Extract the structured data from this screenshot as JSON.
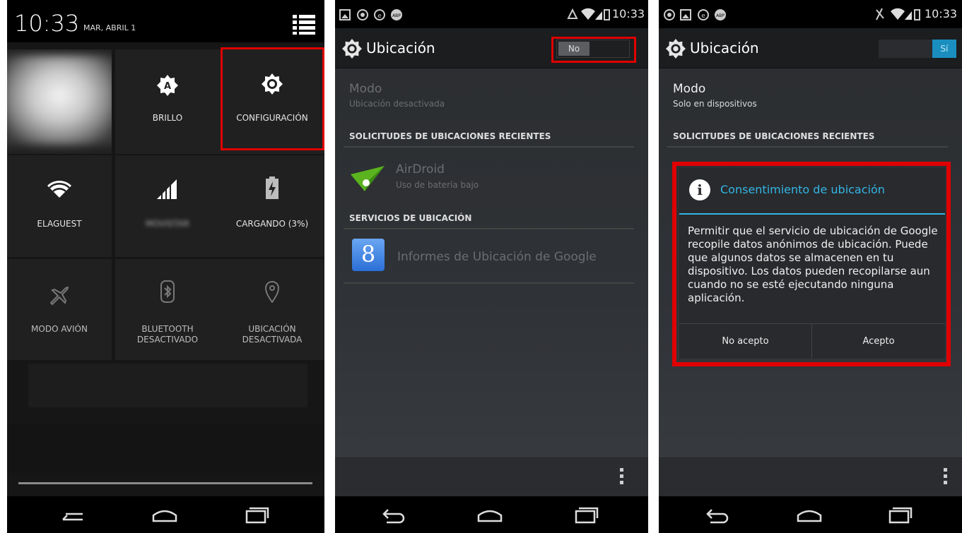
{
  "panel1": {
    "time": "10:33",
    "date": "MAR, ABRIL 1",
    "tiles": [
      {
        "label": "BRILLO",
        "icon": "brightness-auto-icon"
      },
      {
        "label": "CONFIGURACIÓN",
        "icon": "gear-icon"
      },
      {
        "label": "ELAGUEST",
        "icon": "wifi-icon"
      },
      {
        "label": "MOVISTAR",
        "icon": "signal-icon"
      },
      {
        "label": "CARGANDO (3%)",
        "icon": "battery-charging-icon"
      },
      {
        "label": "MODO AVIÓN",
        "icon": "airplane-icon"
      },
      {
        "label": "BLUETOOTH DESACTIVADO",
        "icon": "bluetooth-icon"
      },
      {
        "label": "UBICACIÓN DESACTIVADA",
        "icon": "location-pin-icon"
      }
    ]
  },
  "panel2": {
    "status_time": "10:33",
    "title": "Ubicación",
    "toggle_label": "No",
    "mode_label": "Modo",
    "mode_value": "Ubicación desactivada",
    "recent_header": "SOLICITUDES DE UBICACIONES RECIENTES",
    "recent_app_name": "AirDroid",
    "recent_app_sub": "Uso de batería bajo",
    "services_header": "SERVICIOS DE UBICACIÓN",
    "service_name": "Informes de Ubicación de Google"
  },
  "panel3": {
    "status_time": "10:33",
    "title": "Ubicación",
    "toggle_label": "Sí",
    "mode_label": "Modo",
    "mode_value": "Solo en dispositivos",
    "recent_header": "SOLICITUDES DE UBICACIONES RECIENTES",
    "dialog": {
      "title": "Consentimiento de ubicación",
      "body": "Permitir que el servicio de ubicación de Google recopile datos anónimos de ubicación. Puede que algunos datos se almacenen en tu dispositivo. Los datos pueden recopilarse aun cuando no se esté ejecutando ninguna aplicación.",
      "decline": "No acepto",
      "accept": "Acepto"
    }
  },
  "colors": {
    "highlight": "#e00000",
    "holo_blue": "#33b5e5",
    "switch_on": "#1a8fbf"
  }
}
